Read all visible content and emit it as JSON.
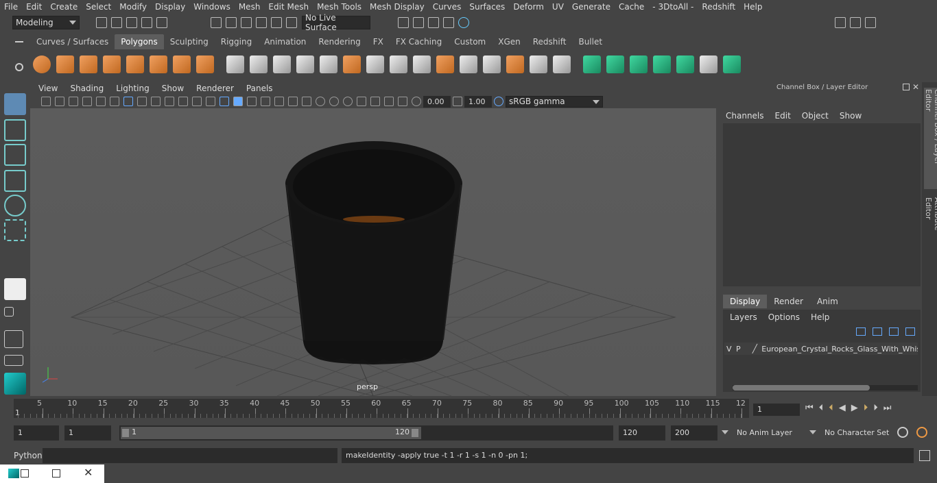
{
  "menubar": [
    "File",
    "Edit",
    "Create",
    "Select",
    "Modify",
    "Display",
    "Windows",
    "Mesh",
    "Edit Mesh",
    "Mesh Tools",
    "Mesh Display",
    "Curves",
    "Surfaces",
    "Deform",
    "UV",
    "Generate",
    "Cache",
    "- 3DtoAll -",
    "Redshift",
    "Help"
  ],
  "status": {
    "workspace": "Modeling",
    "live_surface": "No Live Surface"
  },
  "shelf_tabs": [
    "Curves / Surfaces",
    "Polygons",
    "Sculpting",
    "Rigging",
    "Animation",
    "Rendering",
    "FX",
    "FX Caching",
    "Custom",
    "XGen",
    "Redshift",
    "Bullet"
  ],
  "shelf_active": "Polygons",
  "viewport": {
    "menus": [
      "View",
      "Shading",
      "Lighting",
      "Show",
      "Renderer",
      "Panels"
    ],
    "exposure": "0.00",
    "gamma": "1.00",
    "color_space": "sRGB gamma",
    "camera_label": "persp"
  },
  "channel_box": {
    "title": "Channel Box / Layer Editor",
    "menus": [
      "Channels",
      "Edit",
      "Object",
      "Show"
    ],
    "tabs": [
      "Display",
      "Render",
      "Anim"
    ],
    "active_tab": "Display",
    "layer_menus": [
      "Layers",
      "Options",
      "Help"
    ],
    "layer": {
      "v": "V",
      "p": "P",
      "name": "European_Crystal_Rocks_Glass_With_Whisl"
    }
  },
  "side_tabs": [
    "Channel Box / Layer Editor",
    "Attribute Editor"
  ],
  "timeline": {
    "ticks": [
      "5",
      "10",
      "15",
      "20",
      "25",
      "30",
      "35",
      "40",
      "45",
      "50",
      "55",
      "60",
      "65",
      "70",
      "75",
      "80",
      "85",
      "90",
      "95",
      "100",
      "105",
      "110",
      "115",
      "12"
    ],
    "start_tick": "1",
    "current_frame": "1"
  },
  "range": {
    "start": "1",
    "playback_start": "1",
    "slider_start": "1",
    "slider_end": "120",
    "playback_end": "120",
    "end": "200",
    "anim_layer": "No Anim Layer",
    "char_set": "No Character Set"
  },
  "command": {
    "lang": "Python",
    "feedback": "makeIdentity -apply true -t 1 -r 1 -s 1 -n 0 -pn 1;"
  }
}
